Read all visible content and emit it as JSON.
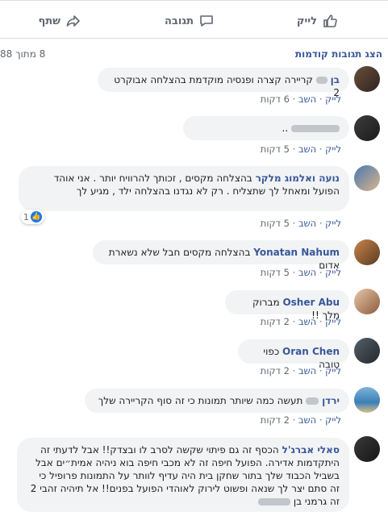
{
  "actions": {
    "like": "לייק",
    "comment": "תגובה",
    "share": "שתף"
  },
  "previous": {
    "link": "הצג תגובות קודמות",
    "count": "8 מתוך 88"
  },
  "meta_labels": {
    "like": "לייק",
    "reply": "השב",
    "sep": "·"
  },
  "comments": [
    {
      "name": "בן",
      "text": "קריירה קצרה ופנסיה מוקדמת בהצלחה אבוקרט 2",
      "time": "6 דקות"
    },
    {
      "name": "",
      "text": "..",
      "time": "5 דקות"
    },
    {
      "name": "נועה ואלמוג מלקר",
      "text": "בהצלחה מקסים , זכותך להרוויח יותר . אני אוהד הפועל ומאחל לך שתצליח . רק לא נגדנו בהצלחה ילד , מגיע לך",
      "time": "5 דקות",
      "reactions": "1"
    },
    {
      "name": "Yonatan Nahum",
      "text": "בהצלחה מקסים חבל שלא נשארת אדום",
      "time": "5 דקות"
    },
    {
      "name": "Osher Abu",
      "text": "מברוק מלך !!",
      "time": "2 דקות"
    },
    {
      "name": "Oran Chen",
      "text": "כפוי טובה",
      "time": "2 דקות"
    },
    {
      "name": "ירדן",
      "text": "תעשה כמה שיותר תמונות כי זה סוף הקריירה שלך",
      "time": "2 דקות"
    },
    {
      "name": "סאלי אברג'ל",
      "text": "הכסף זה גם פיתוי שקשה לסרב לו ובצדק!! אבל לדעתי זה היתקדמות אדירה. הפועל חיפה זה לא מכבי חיפה בוא ניהיה אמית״ים אבל בשביל הכבוד שלך בתור שחקן בית היה עדיף לוותר על התמונות פרופיל כי זה סתם יצר לך שנאה ופשוט לירוק לאוהדי הפועל בפנים!! אל תיהיה זהבי 2 זה גרמני בן",
      "time": ""
    }
  ],
  "colors": {
    "link": "#385898",
    "bubble": "#f2f3f5",
    "meta": "#606770"
  }
}
